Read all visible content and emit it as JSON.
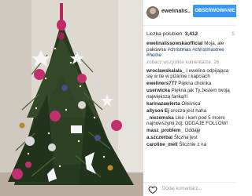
{
  "header": {
    "username": "ewelinalis...",
    "follow_label": "OBSERWOWANIE"
  },
  "post": {
    "likes_label": "Liczba polubień:",
    "likes_count": "3,412",
    "age": "5"
  },
  "caption": {
    "user": "ewelinalissowskaofficial",
    "text": "Moja, ale pakowna",
    "tags": "#christmas #christmastree #home"
  },
  "load_more": "zobacz wszystkie komentarze: 26",
  "comments": [
    {
      "user": "wroclawskalala_",
      "text": "I ewelina odpijająca się w tle w piżamie i kapciach"
    },
    {
      "user": "eweliners777",
      "text": "Piękna choinka"
    },
    {
      "user": "userwicka",
      "text": "Piękna jak Ty.Jestem twoją największą fanką!!!"
    },
    {
      "user": "karinazawierta",
      "text": "Oleśnica"
    },
    {
      "user": "allyson Ej",
      "text": "urocza jest haha"
    },
    {
      "user": "_niezemska",
      "text": "Like i kom pod 5 moimi najnowszymi zdj. ODDAJE FOLLOW!"
    },
    {
      "user": "masz_problem_",
      "text": "Oddaję"
    },
    {
      "user": "a.szczerbal",
      "text": "Ślczna jest"
    },
    {
      "user": "caroline_mell",
      "text": "Ślicznie z na"
    }
  ],
  "footer": {
    "add_comment_placeholder": "Dodaj komentarz..."
  },
  "colors": {
    "follow": "#3897f0",
    "link": "#003569",
    "muted": "#999999"
  }
}
